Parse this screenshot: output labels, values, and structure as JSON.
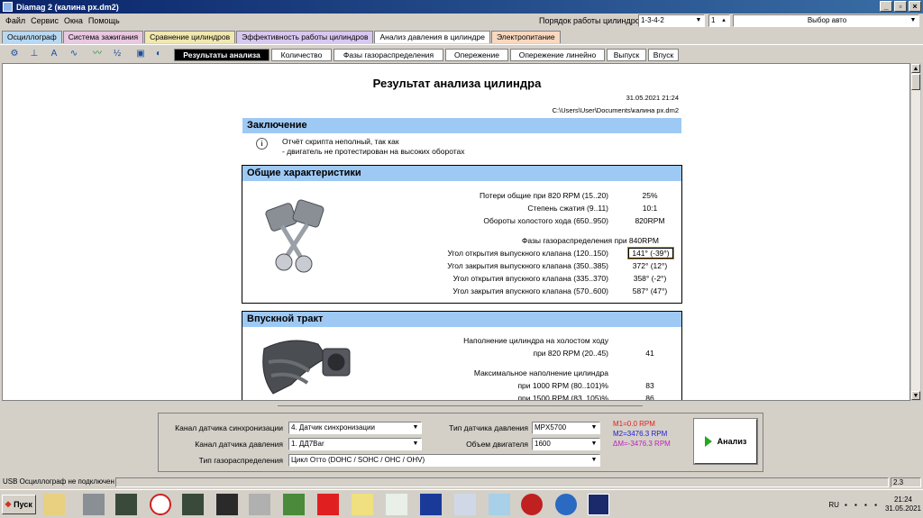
{
  "window": {
    "title": "Diamag 2 (калина px.dm2)"
  },
  "menu": [
    "Файл",
    "Сервис",
    "Окна",
    "Помощь"
  ],
  "header": {
    "cyl_order_label": "Порядок работы цилиндров",
    "cyl_order_value": "1-3-4-2",
    "cyl_num_value": "1",
    "car_select": "Выбор авто"
  },
  "main_tabs": [
    {
      "label": "Осциллограф",
      "color": "#b8d8f0"
    },
    {
      "label": "Система зажигания",
      "color": "#e8c8e0"
    },
    {
      "label": "Сравнение цилиндров",
      "color": "#f0e8b0"
    },
    {
      "label": "Эффективность работы цилиндров",
      "color": "#d8c8f0"
    },
    {
      "label": "Анализ давления в цилиндре",
      "color": "#ffffff"
    },
    {
      "label": "Электропитание",
      "color": "#f8d8c0"
    }
  ],
  "sub_tabs": [
    "Результаты анализа",
    "Количество",
    "Фазы газораспределения",
    "Опережение",
    "Опережение линейно",
    "Выпуск",
    "Впуск"
  ],
  "report": {
    "title": "Результат анализа цилиндра",
    "date": "31.05.2021 21:24",
    "path": "C:\\Users\\User\\Documents\\калина px.dm2",
    "conclusion": {
      "heading": "Заключение",
      "line1": "Отчёт скрипта неполный, так как",
      "line2": "- двигатель не протестирован на высоких оборотах"
    },
    "general": {
      "heading": "Общие характеристики",
      "rows": [
        {
          "label": "Потери общие при 820 RPM (15..20)",
          "value": "25%"
        },
        {
          "label": "Степень сжатия (9..11)",
          "value": "10:1"
        },
        {
          "label": "Обороты холостого хода (650..950)",
          "value": "820RPM"
        }
      ],
      "phases_label": "Фазы газораспределения при 840RPM",
      "phases": [
        {
          "label": "Угол открытия выпускного клапана (120..150)",
          "value": "141° (-39°)"
        },
        {
          "label": "Угол закрытия выпускного клапана (350..385)",
          "value": "372° (12°)"
        },
        {
          "label": "Угол открытия впускного клапана (335..370)",
          "value": "358° (-2°)"
        },
        {
          "label": "Угол закрытия впускного клапана (570..600)",
          "value": "587° (47°)"
        }
      ]
    },
    "intake": {
      "heading": "Впускной тракт",
      "fill_idle_label": "Наполнение цилиндра на холостом ходу",
      "fill_idle_row": {
        "label": "при 820 RPM (20..45)",
        "value": "41"
      },
      "max_fill_label": "Максимальное наполнение цилиндра",
      "rows": [
        {
          "label": "при  1000 RPM (80..101)%",
          "value": "83"
        },
        {
          "label": "при  1500 RPM (83..105)%",
          "value": "86"
        }
      ]
    }
  },
  "settings": {
    "sync_channel_label": "Канал датчика синхронизации",
    "sync_channel_value": "4.  Датчик синхронизации",
    "pressure_channel_label": "Канал датчика давления",
    "pressure_channel_value": "1.  ДД7Bar",
    "timing_type_label": "Тип газораспределения",
    "timing_type_value": "Цикл Отто (DOHC / SOHC / OHC / OHV)",
    "sensor_type_label": "Тип датчика давления",
    "sensor_type_value": "MPX5700",
    "engine_volume_label": "Объем двигателя",
    "engine_volume_value": "1600"
  },
  "markers": {
    "m1": "M1=0.0 RPM",
    "m2": "M2=3476.3 RPM",
    "dm": "ΔM=-3476.3 RPM"
  },
  "analyze_button": "Анализ",
  "status": {
    "usb": "USB Осциллограф не подключен",
    "version": "2.3"
  },
  "taskbar": {
    "start": "Пуск",
    "lang": "RU",
    "time": "21:24",
    "date": "31.05.2021"
  }
}
